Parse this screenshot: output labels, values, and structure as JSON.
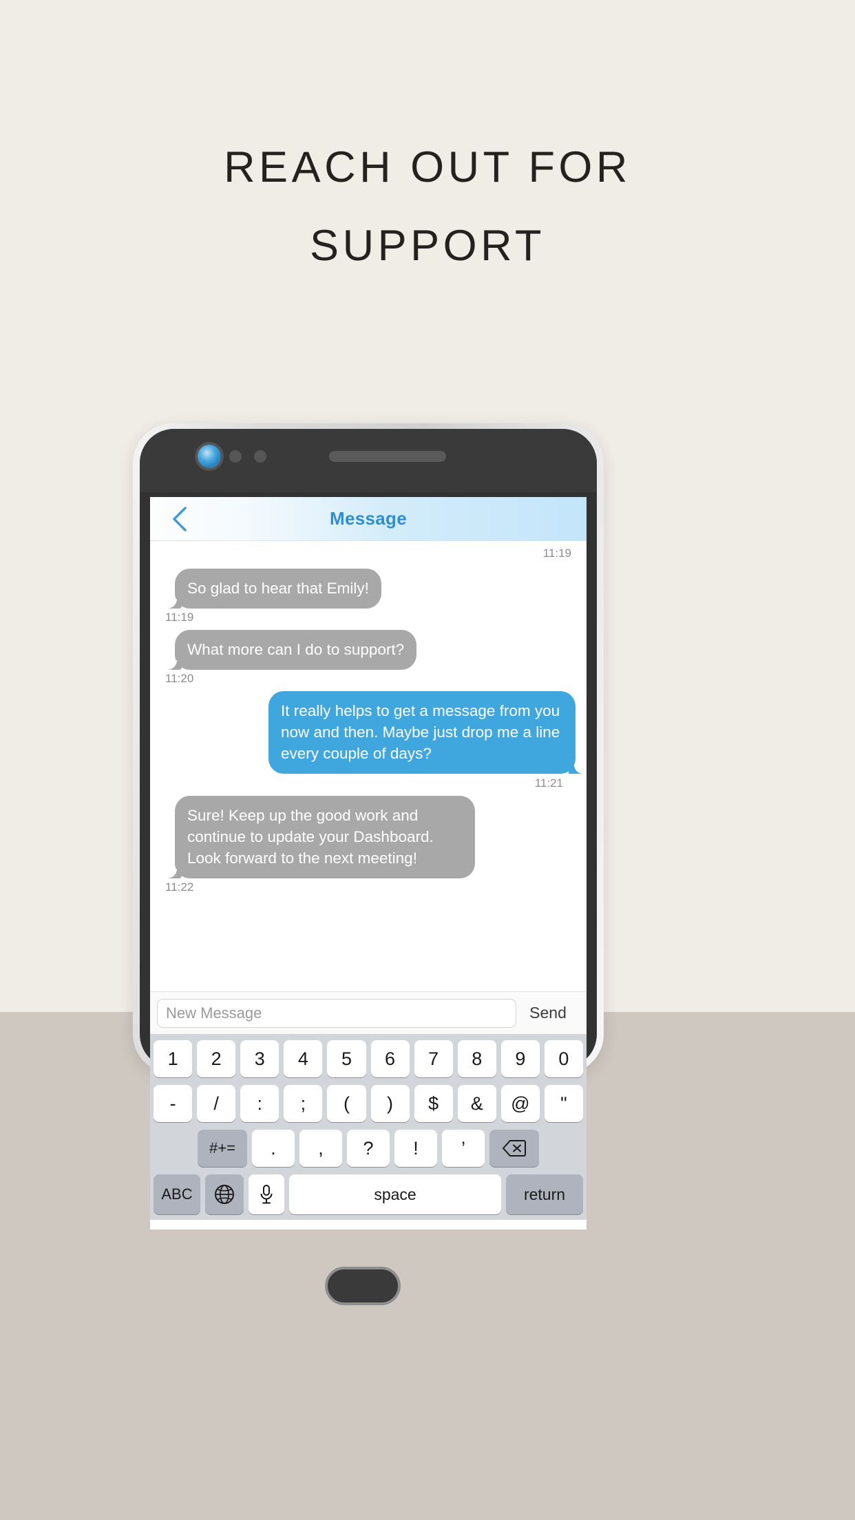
{
  "poster": {
    "headline": "REACH OUT FOR\nSUPPORT",
    "background_upper": "#f0ece6",
    "background_lower": "#cec8c0"
  },
  "phone": {
    "camera_icon": "camera-lens-icon",
    "speaker_icon": "speaker-grille-icon",
    "home_button": "home-button"
  },
  "screen": {
    "header": {
      "back_icon": "back-chevron-icon",
      "title": "Message",
      "title_color": "#2f8fcc"
    },
    "conversation": {
      "top_timestamp": "11:19",
      "messages": [
        {
          "direction": "incoming",
          "text": "So glad to hear that Emily!",
          "time": "11:19",
          "color": "#a8a8a8"
        },
        {
          "direction": "incoming",
          "text": "What more can I do to support?",
          "time": "11:20",
          "color": "#a8a8a8"
        },
        {
          "direction": "outgoing",
          "text": "It really helps to get a message from you now and then. Maybe just drop me a line every couple of days?",
          "time": "11:21",
          "color": "#3fa7dd"
        },
        {
          "direction": "incoming",
          "text": "Sure! Keep up the good work and continue to update your Dashboard. Look forward to the next meeting!",
          "time": "11:22",
          "color": "#a8a8a8"
        }
      ]
    },
    "input_bar": {
      "placeholder": "New Message",
      "value": "",
      "send_label": "Send"
    },
    "keyboard": {
      "row1": [
        "1",
        "2",
        "3",
        "4",
        "5",
        "6",
        "7",
        "8",
        "9",
        "0"
      ],
      "row2": [
        "-",
        "/",
        ":",
        ";",
        "(",
        ")",
        "$",
        "&",
        "@",
        "\""
      ],
      "row3": {
        "symbols_key": "#+=",
        "keys": [
          ".",
          ",",
          "?",
          "!",
          "’"
        ],
        "backspace_icon": "backspace-icon"
      },
      "row4": {
        "abc_label": "ABC",
        "globe_icon": "globe-icon",
        "mic_icon": "microphone-icon",
        "space_label": "space",
        "return_label": "return"
      }
    }
  }
}
